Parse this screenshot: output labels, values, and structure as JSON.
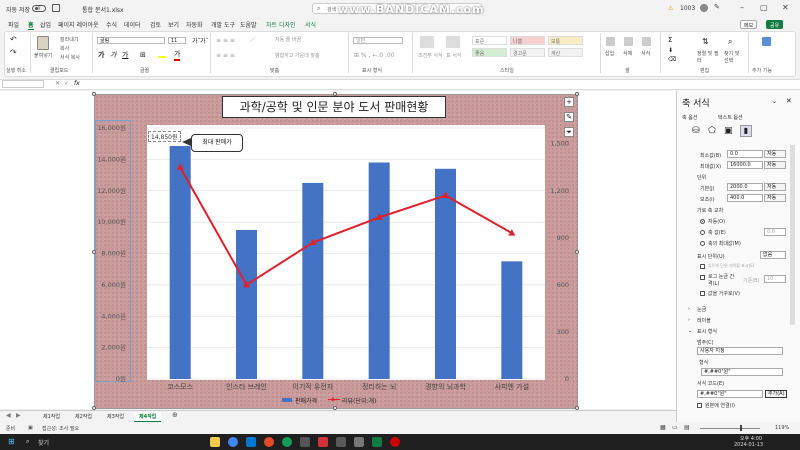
{
  "titlebar": {
    "autosave": "자동 저장",
    "off": "끔",
    "filename": "통합 문서1.xlsx",
    "search": "검색",
    "user_num": "1003",
    "watermark": "www.BANDICAM.com"
  },
  "menu": {
    "tabs": [
      "파일",
      "홈",
      "삽입",
      "페이지 레이아웃",
      "수식",
      "데이터",
      "검토",
      "보기",
      "자동화",
      "개발 도구",
      "도움말",
      "차트 디자인",
      "서식"
    ],
    "memo": "메모",
    "share": "공유"
  },
  "ribbon": {
    "undo_label": "실행 취소",
    "clipboard": {
      "paste": "붙여넣기",
      "cut": "잘라내기",
      "copy": "복사",
      "format": "서식 복사",
      "label": "클립보드"
    },
    "font": {
      "name": "굴림",
      "size": "11",
      "label": "글꼴"
    },
    "align": {
      "wrap": "자동 줄 바꿈",
      "merge": "병합하고 가운데 맞춤",
      "label": "맞춤"
    },
    "number": {
      "format": "일반",
      "label": "표시 형식"
    },
    "styles": {
      "cond": "조건부 서식",
      "table": "표 서식",
      "boxes": [
        "표준",
        "나쁨",
        "보통",
        "좋음",
        "경고문",
        "계산"
      ],
      "label": "스타일"
    },
    "cells": {
      "insert": "삽입",
      "delete": "삭제",
      "format": "서식",
      "label": "셀"
    },
    "edit": {
      "sort": "정렬 및 필터",
      "find": "찾기 및 선택",
      "label": "편집"
    },
    "addin": {
      "label": "추가 기능"
    }
  },
  "formula": {
    "fx": "fx"
  },
  "chart_data": {
    "type": "bar",
    "title": "과학/공학 및 인문 분야 도서 판매현황",
    "categories": [
      "코스모스",
      "인스타 브레인",
      "이기적 유전자",
      "정리하는 뇌",
      "경향의 뇌과학",
      "사피엔 가설"
    ],
    "series": [
      {
        "name": "판매가격",
        "type": "bar",
        "axis": "left",
        "color": "#4472c4",
        "values": [
          14850,
          9500,
          12500,
          13800,
          13400,
          7500
        ]
      },
      {
        "name": "리뷰(단위:개)",
        "type": "line",
        "axis": "right",
        "color": "#e0202a",
        "values": [
          1350,
          600,
          870,
          1030,
          1170,
          930
        ]
      }
    ],
    "ylim": [
      0,
      16000
    ],
    "y_ticks": [
      "0원",
      "2,000원",
      "4,000원",
      "6,000원",
      "8,000원",
      "10,000원",
      "12,000원",
      "14,000원",
      "16,000원"
    ],
    "y2lim": [
      0,
      1600
    ],
    "y2_ticks": [
      "0",
      "300",
      "600",
      "900",
      "1,200",
      "1,500"
    ],
    "data_label": "14,850원",
    "callout": "최대 판매가",
    "legend": "bottom"
  },
  "sheet_tabs": [
    "제1작업",
    "제2작업",
    "제3작업",
    "제4작업"
  ],
  "status": {
    "ready": "준비",
    "access": "접근성: 조사 필요",
    "zoom": "119%"
  },
  "taskbar": {
    "search": "찾기",
    "time": "오후 4:00",
    "date": "2024-01-13"
  },
  "pane": {
    "title": "축 서식",
    "tab1": "축 옵션",
    "tab2": "텍스트 옵션",
    "bounds_min_label": "최소값(B)",
    "bounds_min": "0.0",
    "bounds_max_label": "최대값(X)",
    "bounds_max": "16000.0",
    "auto": "자동",
    "units": "단위",
    "major_label": "기본(J)",
    "major": "2000.0",
    "minor_label": "보조(I)",
    "minor": "400.0",
    "cross_label": "가로 축 교차",
    "r_auto": "자동(O)",
    "r_value": "축 값(E)",
    "r_value_v": "0.0",
    "r_max": "축의 최대값(M)",
    "display_label": "표시 단위(U)",
    "display_value": "없음",
    "show_unit": "차트에 단위 레이블 표시(S)",
    "log": "로그 눈금 간격(L)",
    "log_base_label": "기준(B)",
    "log_base": "10",
    "reverse": "값을 거꾸로(V)",
    "sec_ticks": "눈금",
    "sec_labels": "레이블",
    "sec_number": "표시 형식",
    "category_label": "범주(C)",
    "category": "사용자 지정",
    "type_label": "형식",
    "type": "#,##0\"원\"",
    "code_label": "서식 코드(E)",
    "code": "#,##0\"원\"",
    "add": "추가(A)",
    "link": "원본에 연결(I)"
  }
}
